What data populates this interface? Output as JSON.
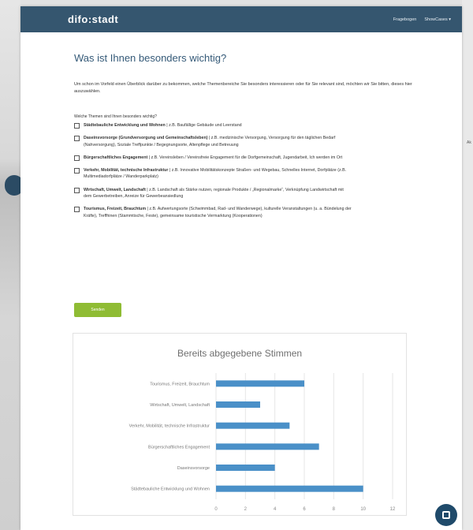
{
  "header": {
    "logo": "difo:stadt",
    "nav": [
      "Fragebogen",
      "ShowCases ▾"
    ]
  },
  "page": {
    "title": "Was ist Ihnen besonders wichtig?",
    "intro": "Um schon im Vorfeld einen Überblick darüber zu bekommen, welche Themenbereiche Sie besonders interessieren oder für Sie relevant sind, möchten wir Sie bitten, dieses hier auszuwählen.",
    "question": "Welche Themen sind Ihnen besonders wichtig?",
    "options": [
      {
        "bold": "Städtebauliche Entwicklung und Wohnen",
        "rest": " | z.B. Baufällige Gebäude und Leerstand"
      },
      {
        "bold": "Daseinsvorsorge (Grundversorgung und Gemeinschaftsleben)",
        "rest": " | z.B. medizinische Versorgung, Versorgung für den täglichen Bedarf (Nahversorgung), Soziale Treffpunkte / Begegnungsorte, Altenpflege und Betreuung"
      },
      {
        "bold": "Bürgerschaftliches Engagement",
        "rest": " | z.B. Vereinsleben / Vereinsfreie Engagement für die Dorfgemeinschaft, Jugendarbeit, Ich werden im Ort"
      },
      {
        "bold": "Verkehr, Mobilität, technische Infrastruktur",
        "rest": " | z.B. Innovative Mobilitätskonzepte Straßen- und Wegebau, Schnelles Internet, Dorfplätze (z.B. Multimediadorfplätze / Wanderparkplatz)"
      },
      {
        "bold": "Wirtschaft, Umwelt, Landschaft",
        "rest": " | z.B. Landschaft als Stärke nutzen, regionale Produkte / „Regionalmarke“, Verknüpfung Landwirtschaft mit dem Gewerbetreiben, Anreize für Gewerbeansiedlung"
      },
      {
        "bold": "Tourismus, Freizeit, Brauchtum",
        "rest": " | z.B. Aufwertungsorte (Schwimmbad, Rad- und Wanderwege), kulturelle Veranstaltungen (u. a. Bündelung der Kräfte), Treffhinen (Stammtische, Feste), gemeinsame touristische Vermarktung (Kooperationen)"
      }
    ],
    "send_label": "Senden"
  },
  "chart_data": {
    "type": "bar",
    "orientation": "horizontal",
    "title": "Bereits abgegebene Stimmen",
    "categories": [
      "Tourismus, Freizeit, Brauchtum",
      "Wirtschaft, Umwelt, Landschaft",
      "Verkehr, Mobilität, technische Infrastruktur",
      "Bürgerschaftliches Engagement",
      "Daseinsvorsorge",
      "Städtebauliche Entwicklung und Wohnen"
    ],
    "values": [
      6,
      3,
      5,
      7,
      4,
      10
    ],
    "xlim": [
      0,
      12
    ],
    "xticks": [
      0,
      2,
      4,
      6,
      8,
      10,
      12
    ],
    "grid": true,
    "bar_color": "#4a90c8"
  },
  "side_tab": "Ak",
  "colors": {
    "header": "#35566f",
    "accent": "#8fbc34",
    "title": "#355a78"
  }
}
